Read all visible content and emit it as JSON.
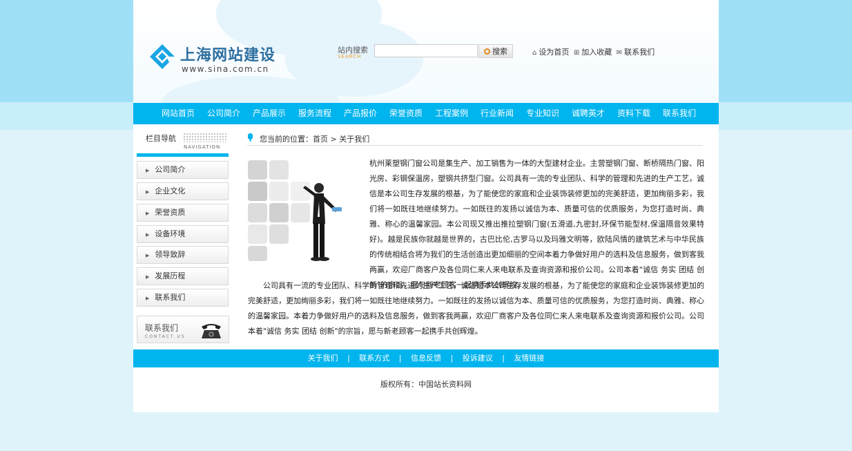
{
  "header": {
    "site_title": "上海网站建设",
    "site_url": "www.sina.com.cn",
    "search_label": "站内搜索",
    "search_sub": "SEARCH",
    "search_value": "",
    "search_button": "搜索",
    "top_links": [
      "设为首页",
      "加入收藏",
      "联系我们"
    ]
  },
  "nav": [
    "网站首页",
    "公司简介",
    "产品展示",
    "服务流程",
    "产品报价",
    "荣誉资质",
    "工程案例",
    "行业新闻",
    "专业知识",
    "诚聘英才",
    "资料下载",
    "联系我们"
  ],
  "sidebar": {
    "title": "栏目导航",
    "title_sub": "NAVIGATION",
    "items": [
      "公司简介",
      "企业文化",
      "荣誉资质",
      "设备环境",
      "领导致辞",
      "发展历程",
      "联系我们"
    ],
    "contact_title": "联系我们",
    "contact_sub": "CONTACT US"
  },
  "main": {
    "location": "您当前的位置：首页 > 关于我们",
    "paragraph1": "杭州莱塑钢门窗公司是集生产、加工销售为一体的大型建材企业。主营塑钢门窗、断桥隔热门窗、阳光房、彩钢保温房，塑钢共挤型门窗。公司具有一流的专业团队、科学的管理和先进的生产工艺，诚信是本公司生存发展的根基，为了能使您的家庭和企业装饰装修更加的完美舒适，更加绚丽多彩，我们将一如既往地继续努力。一如既往的发扬以诚信为本、质量可信的优质服务，为您打造时尚、典雅、称心的温馨家园。本公司现又推出推拉塑钢门窗(五滑道,九密封,环保节能型材,保温隔音效果特好)。越是民族你就越是世界的，古巴比伦,古罗马以及玛雅文明等，欧陆风情的建筑艺术与中华民族的传统相结合将为我们的生活创造出更加细丽的空间本着力争做好用户的选料及信息服务，做到客我两赢，欢迎厂商客户及各位同仁来人来电联系及查询资源和报价公司。公司本着\"诚信 务实 团结 创新\"的宗旨，愿与新老顾客一起携手共创辉煌。",
    "paragraph2": "公司具有一流的专业团队、科学的管理和先进的生产工艺，诚信是本公司生存发展的根基，为了能使您的家庭和企业装饰装修更加的完美舒适，更加绚丽多彩，我们将一如既往地继续努力。一如既往的发扬以诚信为本、质量可信的优质服务，为您打造时尚、典雅、称心的温馨家园。本着力争做好用户的选料及信息服务，做到客我两赢，欢迎厂商客户及各位同仁来人来电联系及查询资源和报价公司。公司本着\"诚信 务实 团结 创新\"的宗旨，愿与新老顾客一起携手共创辉煌。"
  },
  "footer": {
    "links": [
      "关于我们",
      "联系方式",
      "信息反馈",
      "投诉建议",
      "友情链接"
    ],
    "separator": "|",
    "copyright": "版权所有：中国站长资料网"
  },
  "colors": {
    "accent": "#00b4ee",
    "band": "#9fe0f6",
    "page_bg": "#dff3fb"
  }
}
